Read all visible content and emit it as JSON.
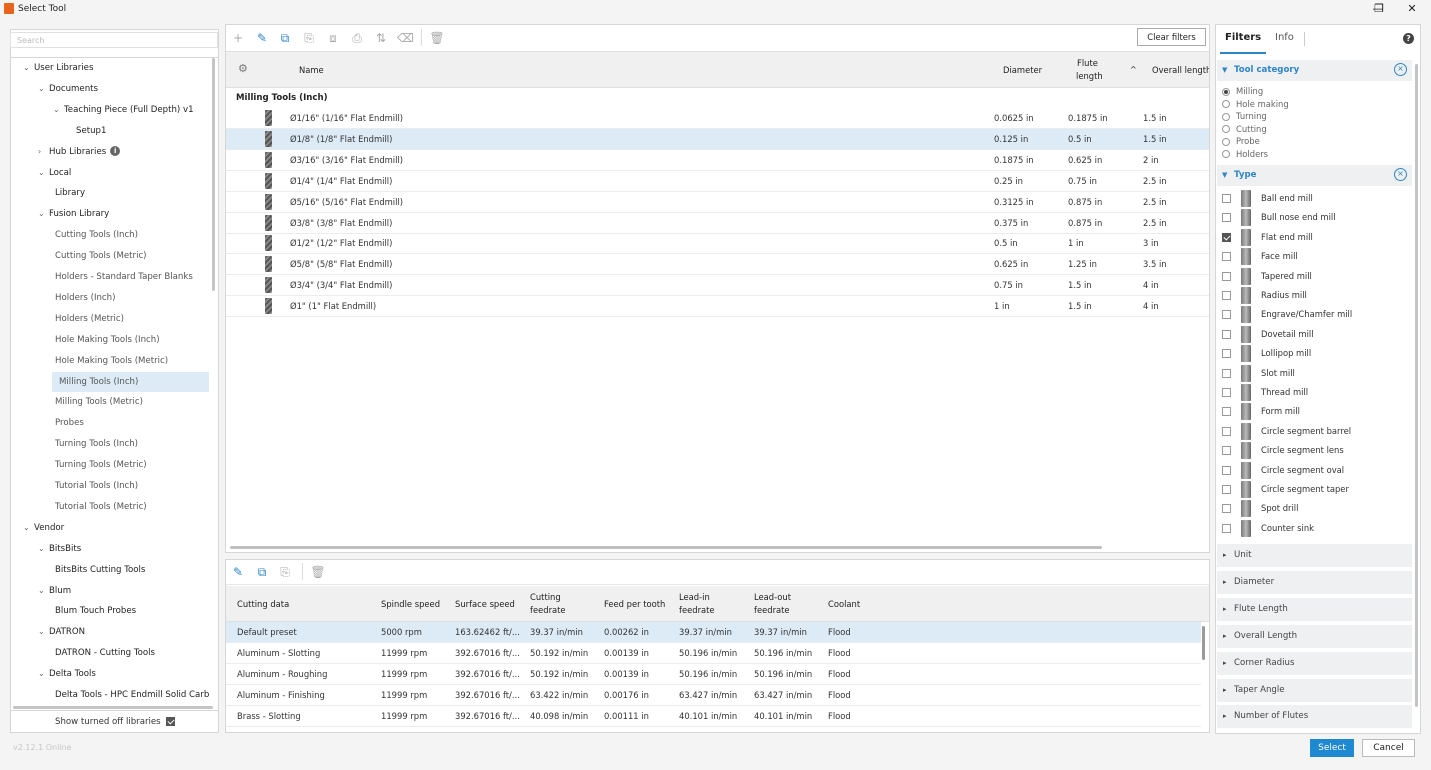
{
  "window": {
    "title": "Select Tool",
    "minimize": "—",
    "maximize": "❐",
    "close": "✕"
  },
  "search": {
    "placeholder": "Search"
  },
  "tree": [
    {
      "label": "User Libraries",
      "chev": "v",
      "indent": 0
    },
    {
      "label": "Documents",
      "chev": "v",
      "indent": 1
    },
    {
      "label": "Teaching Piece (Full Depth) v1",
      "chev": "v",
      "indent": 2
    },
    {
      "label": "Setup1",
      "chev": "",
      "indent": 3
    },
    {
      "label": "Hub Libraries",
      "chev": ">",
      "indent": 1,
      "info": true
    },
    {
      "label": "Local",
      "chev": "v",
      "indent": 1
    },
    {
      "label": "Library",
      "chev": "",
      "indent": 2
    },
    {
      "label": "Fusion Library",
      "chev": "v",
      "indent": 1
    },
    {
      "label": "Cutting Tools (Inch)",
      "chev": "",
      "indent": 2,
      "gray": true
    },
    {
      "label": "Cutting Tools (Metric)",
      "chev": "",
      "indent": 2,
      "gray": true
    },
    {
      "label": "Holders - Standard Taper Blanks",
      "chev": "",
      "indent": 2,
      "gray": true
    },
    {
      "label": "Holders (Inch)",
      "chev": "",
      "indent": 2,
      "gray": true
    },
    {
      "label": "Holders (Metric)",
      "chev": "",
      "indent": 2,
      "gray": true
    },
    {
      "label": "Hole Making Tools (Inch)",
      "chev": "",
      "indent": 2,
      "gray": true
    },
    {
      "label": "Hole Making Tools (Metric)",
      "chev": "",
      "indent": 2,
      "gray": true
    },
    {
      "label": "Milling Tools (Inch)",
      "chev": "",
      "indent": 2,
      "gray": true,
      "selected": true
    },
    {
      "label": "Milling Tools (Metric)",
      "chev": "",
      "indent": 2,
      "gray": true
    },
    {
      "label": "Probes",
      "chev": "",
      "indent": 2,
      "gray": true
    },
    {
      "label": "Turning Tools (Inch)",
      "chev": "",
      "indent": 2,
      "gray": true
    },
    {
      "label": "Turning Tools (Metric)",
      "chev": "",
      "indent": 2,
      "gray": true
    },
    {
      "label": "Tutorial Tools (Inch)",
      "chev": "",
      "indent": 2,
      "gray": true
    },
    {
      "label": "Tutorial Tools (Metric)",
      "chev": "",
      "indent": 2,
      "gray": true
    },
    {
      "label": "Vendor",
      "chev": "v",
      "indent": 0
    },
    {
      "label": "BitsBits",
      "chev": "v",
      "indent": 1
    },
    {
      "label": "BitsBits Cutting Tools",
      "chev": "",
      "indent": 2
    },
    {
      "label": "Blum",
      "chev": "v",
      "indent": 1
    },
    {
      "label": "Blum Touch Probes",
      "chev": "",
      "indent": 2
    },
    {
      "label": "DATRON",
      "chev": "v",
      "indent": 1
    },
    {
      "label": "DATRON - Cutting Tools",
      "chev": "",
      "indent": 2
    },
    {
      "label": "Delta Tools",
      "chev": "v",
      "indent": 1
    },
    {
      "label": "Delta Tools - HPC Endmill Solid Carb",
      "chev": "",
      "indent": 2
    }
  ],
  "show_turned_off": {
    "label": "Show turned off libraries",
    "checked": true
  },
  "version": "v2.12.1 Online",
  "toolbar": {
    "clear_filters": "Clear filters"
  },
  "tool_table": {
    "headers": {
      "name": "Name",
      "diameter": "Diameter",
      "flute_length_1": "Flute",
      "flute_length_2": "length",
      "sort_arrow": "^",
      "overall_length": "Overall length"
    },
    "group": "Milling Tools (Inch)",
    "rows": [
      {
        "name": "Ø1/16\" (1/16\" Flat Endmill)",
        "diameter": "0.0625 in",
        "flute": "0.1875 in",
        "overall": "1.5 in"
      },
      {
        "name": "Ø1/8\" (1/8\" Flat Endmill)",
        "diameter": "0.125 in",
        "flute": "0.5 in",
        "overall": "1.5 in",
        "selected": true
      },
      {
        "name": "Ø3/16\" (3/16\" Flat Endmill)",
        "diameter": "0.1875 in",
        "flute": "0.625 in",
        "overall": "2 in"
      },
      {
        "name": "Ø1/4\" (1/4\" Flat Endmill)",
        "diameter": "0.25 in",
        "flute": "0.75 in",
        "overall": "2.5 in"
      },
      {
        "name": "Ø5/16\" (5/16\" Flat Endmill)",
        "diameter": "0.3125 in",
        "flute": "0.875 in",
        "overall": "2.5 in"
      },
      {
        "name": "Ø3/8\" (3/8\" Flat Endmill)",
        "diameter": "0.375 in",
        "flute": "0.875 in",
        "overall": "2.5 in"
      },
      {
        "name": "Ø1/2\" (1/2\" Flat Endmill)",
        "diameter": "0.5 in",
        "flute": "1 in",
        "overall": "3 in"
      },
      {
        "name": "Ø5/8\" (5/8\" Flat Endmill)",
        "diameter": "0.625 in",
        "flute": "1.25 in",
        "overall": "3.5 in"
      },
      {
        "name": "Ø3/4\" (3/4\" Flat Endmill)",
        "diameter": "0.75 in",
        "flute": "1.5 in",
        "overall": "4 in"
      },
      {
        "name": "Ø1\" (1\" Flat Endmill)",
        "diameter": "1 in",
        "flute": "1.5 in",
        "overall": "4 in"
      }
    ]
  },
  "cutting_table": {
    "headers": {
      "cutting_data": "Cutting data",
      "spindle_speed": "Spindle speed",
      "surface_speed": "Surface speed",
      "cutting_feedrate_1": "Cutting",
      "cutting_feedrate_2": "feedrate",
      "feed_per_tooth": "Feed per tooth",
      "lead_in_1": "Lead-in",
      "lead_in_2": "feedrate",
      "lead_out_1": "Lead-out",
      "lead_out_2": "feedrate",
      "coolant": "Coolant"
    },
    "rows": [
      {
        "name": "Default preset",
        "spindle": "5000 rpm",
        "surface": "163.62462 ft/...",
        "cutting": "39.37 in/min",
        "fpt": "0.00262 in",
        "lead_in": "39.37 in/min",
        "lead_out": "39.37 in/min",
        "coolant": "Flood",
        "selected": true
      },
      {
        "name": "Aluminum - Slotting",
        "spindle": "11999 rpm",
        "surface": "392.67016 ft/...",
        "cutting": "50.192 in/min",
        "fpt": "0.00139 in",
        "lead_in": "50.196 in/min",
        "lead_out": "50.196 in/min",
        "coolant": "Flood"
      },
      {
        "name": "Aluminum - Roughing",
        "spindle": "11999 rpm",
        "surface": "392.67016 ft/...",
        "cutting": "50.192 in/min",
        "fpt": "0.00139 in",
        "lead_in": "50.196 in/min",
        "lead_out": "50.196 in/min",
        "coolant": "Flood"
      },
      {
        "name": "Aluminum - Finishing",
        "spindle": "11999 rpm",
        "surface": "392.67016 ft/...",
        "cutting": "63.422 in/min",
        "fpt": "0.00176 in",
        "lead_in": "63.427 in/min",
        "lead_out": "63.427 in/min",
        "coolant": "Flood"
      },
      {
        "name": "Brass - Slotting",
        "spindle": "11999 rpm",
        "surface": "392.67016 ft/...",
        "cutting": "40.098 in/min",
        "fpt": "0.00111 in",
        "lead_in": "40.101 in/min",
        "lead_out": "40.101 in/min",
        "coolant": "Flood"
      }
    ]
  },
  "filters": {
    "tab_filters": "Filters",
    "tab_info": "Info",
    "help": "?",
    "tool_category": {
      "title": "Tool category",
      "options": [
        {
          "label": "Milling",
          "selected": true
        },
        {
          "label": "Hole making"
        },
        {
          "label": "Turning"
        },
        {
          "label": "Cutting"
        },
        {
          "label": "Probe"
        },
        {
          "label": "Holders"
        }
      ]
    },
    "type": {
      "title": "Type",
      "options": [
        {
          "label": "Ball end mill"
        },
        {
          "label": "Bull nose end mill"
        },
        {
          "label": "Flat end mill",
          "checked": true
        },
        {
          "label": "Face mill"
        },
        {
          "label": "Tapered mill"
        },
        {
          "label": "Radius mill"
        },
        {
          "label": "Engrave/Chamfer mill"
        },
        {
          "label": "Dovetail mill"
        },
        {
          "label": "Lollipop mill"
        },
        {
          "label": "Slot mill"
        },
        {
          "label": "Thread mill"
        },
        {
          "label": "Form mill"
        },
        {
          "label": "Circle segment barrel"
        },
        {
          "label": "Circle segment lens"
        },
        {
          "label": "Circle segment oval"
        },
        {
          "label": "Circle segment taper"
        },
        {
          "label": "Spot drill"
        },
        {
          "label": "Counter sink"
        }
      ]
    },
    "collapsed": [
      "Unit",
      "Diameter",
      "Flute Length",
      "Overall Length",
      "Corner Radius",
      "Taper Angle",
      "Number of Flutes"
    ]
  },
  "buttons": {
    "select": "Select",
    "cancel": "Cancel"
  },
  "colors": {
    "accent": "#1e88d0",
    "selection": "#dcebf6",
    "app_icon": "#e8641b"
  }
}
